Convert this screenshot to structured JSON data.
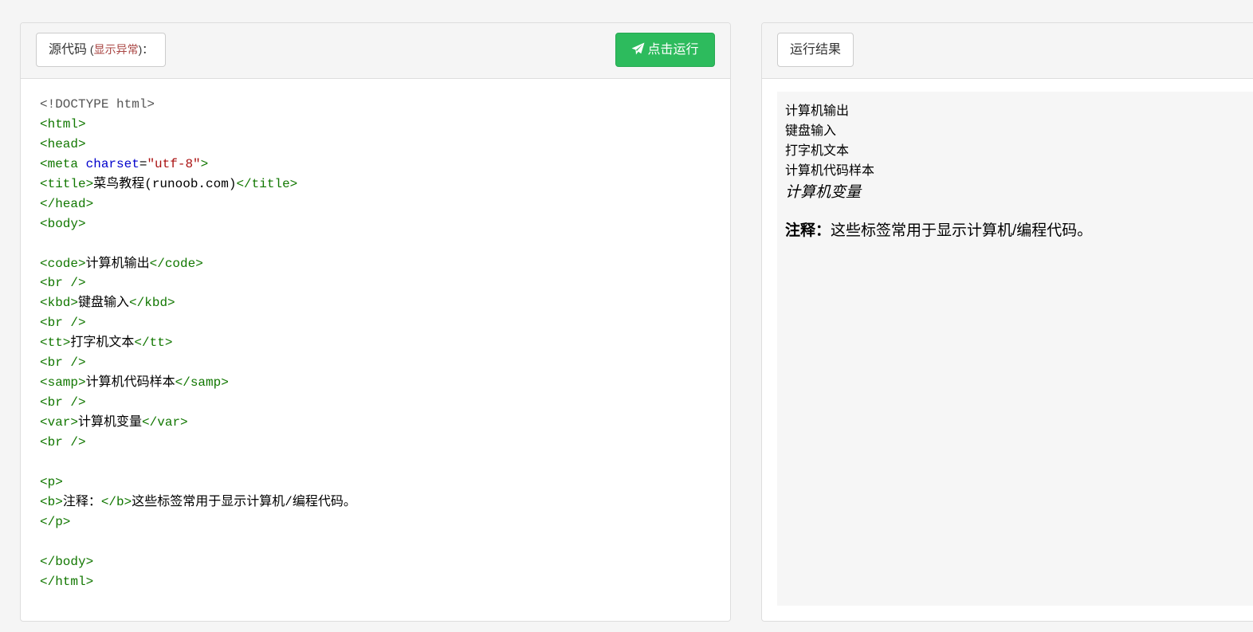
{
  "editor": {
    "title": "源代码",
    "paren_open": " (",
    "error_link": "显示异常",
    "paren_close": ")：",
    "run_label": "点击运行",
    "lines": [
      [
        {
          "c": "t-doctype",
          "t": "<!DOCTYPE html>"
        }
      ],
      [
        {
          "c": "t-tag",
          "t": "<html>"
        }
      ],
      [
        {
          "c": "t-tag",
          "t": "<head>"
        }
      ],
      [
        {
          "c": "t-tag",
          "t": "<meta "
        },
        {
          "c": "t-attr",
          "t": "charset"
        },
        {
          "c": "t-txt",
          "t": "="
        },
        {
          "c": "t-str",
          "t": "\"utf-8\""
        },
        {
          "c": "t-tag",
          "t": ">"
        }
      ],
      [
        {
          "c": "t-tag",
          "t": "<title>"
        },
        {
          "c": "t-txt",
          "t": "菜鸟教程(runoob.com)"
        },
        {
          "c": "t-tag",
          "t": "</title>"
        }
      ],
      [
        {
          "c": "t-tag",
          "t": "</head>"
        }
      ],
      [
        {
          "c": "t-tag",
          "t": "<body>"
        }
      ],
      [],
      [
        {
          "c": "t-tag",
          "t": "<code>"
        },
        {
          "c": "t-txt",
          "t": "计算机输出"
        },
        {
          "c": "t-tag",
          "t": "</code>"
        }
      ],
      [
        {
          "c": "t-tag",
          "t": "<br />"
        }
      ],
      [
        {
          "c": "t-tag",
          "t": "<kbd>"
        },
        {
          "c": "t-txt",
          "t": "键盘输入"
        },
        {
          "c": "t-tag",
          "t": "</kbd>"
        }
      ],
      [
        {
          "c": "t-tag",
          "t": "<br />"
        }
      ],
      [
        {
          "c": "t-tag",
          "t": "<tt>"
        },
        {
          "c": "t-txt",
          "t": "打字机文本"
        },
        {
          "c": "t-tag",
          "t": "</tt>"
        }
      ],
      [
        {
          "c": "t-tag",
          "t": "<br />"
        }
      ],
      [
        {
          "c": "t-tag",
          "t": "<samp>"
        },
        {
          "c": "t-txt",
          "t": "计算机代码样本"
        },
        {
          "c": "t-tag",
          "t": "</samp>"
        }
      ],
      [
        {
          "c": "t-tag",
          "t": "<br />"
        }
      ],
      [
        {
          "c": "t-tag",
          "t": "<var>"
        },
        {
          "c": "t-txt",
          "t": "计算机变量"
        },
        {
          "c": "t-tag",
          "t": "</var>"
        }
      ],
      [
        {
          "c": "t-tag",
          "t": "<br />"
        }
      ],
      [],
      [
        {
          "c": "t-tag",
          "t": "<p>"
        }
      ],
      [
        {
          "c": "t-tag",
          "t": "<b>"
        },
        {
          "c": "t-txt",
          "t": "注释："
        },
        {
          "c": "t-tag",
          "t": "</b>"
        },
        {
          "c": "t-txt",
          "t": "这些标签常用于显示计算机/编程代码。"
        }
      ],
      [
        {
          "c": "t-tag",
          "t": "</p>"
        }
      ],
      [],
      [
        {
          "c": "t-tag",
          "t": "</body>"
        }
      ],
      [
        {
          "c": "t-tag",
          "t": "</html>"
        }
      ]
    ]
  },
  "result": {
    "title": "运行结果",
    "code": "计算机输出",
    "kbd": "键盘输入",
    "tt": "打字机文本",
    "samp": "计算机代码样本",
    "var": "计算机变量",
    "note_bold": "注释：",
    "note_text": "这些标签常用于显示计算机/编程代码。"
  }
}
